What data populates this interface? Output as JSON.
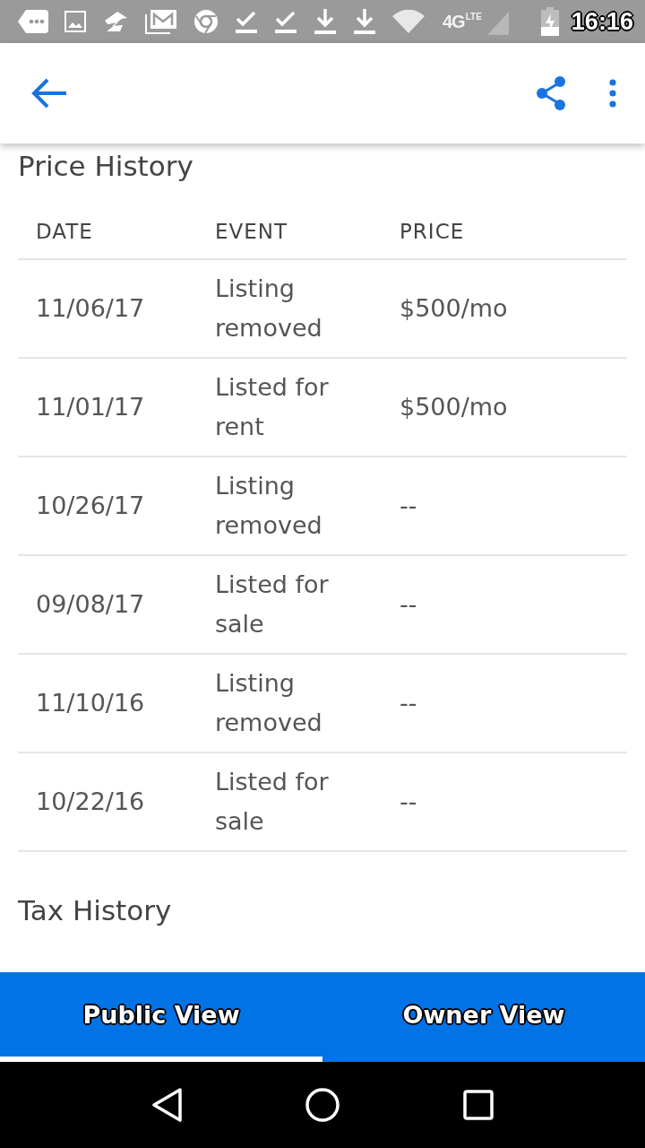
{
  "status_bar": {
    "network": "4G",
    "network_sub": "LTE",
    "time": "16:16"
  },
  "price_history": {
    "title": "Price History",
    "columns": [
      "DATE",
      "EVENT",
      "PRICE"
    ],
    "rows": [
      {
        "date": "11/06/17",
        "event": "Listing removed",
        "price": "$500/mo"
      },
      {
        "date": "11/01/17",
        "event": "Listed for rent",
        "price": "$500/mo"
      },
      {
        "date": "10/26/17",
        "event": "Listing removed",
        "price": "--"
      },
      {
        "date": "09/08/17",
        "event": "Listed for sale",
        "price": "--"
      },
      {
        "date": "11/10/16",
        "event": "Listing removed",
        "price": "--"
      },
      {
        "date": "10/22/16",
        "event": "Listed for sale",
        "price": "--"
      }
    ]
  },
  "tax_history": {
    "title": "Tax History"
  },
  "tabs": [
    {
      "label": "Public View",
      "selected": true
    },
    {
      "label": "Owner View",
      "selected": false
    }
  ]
}
